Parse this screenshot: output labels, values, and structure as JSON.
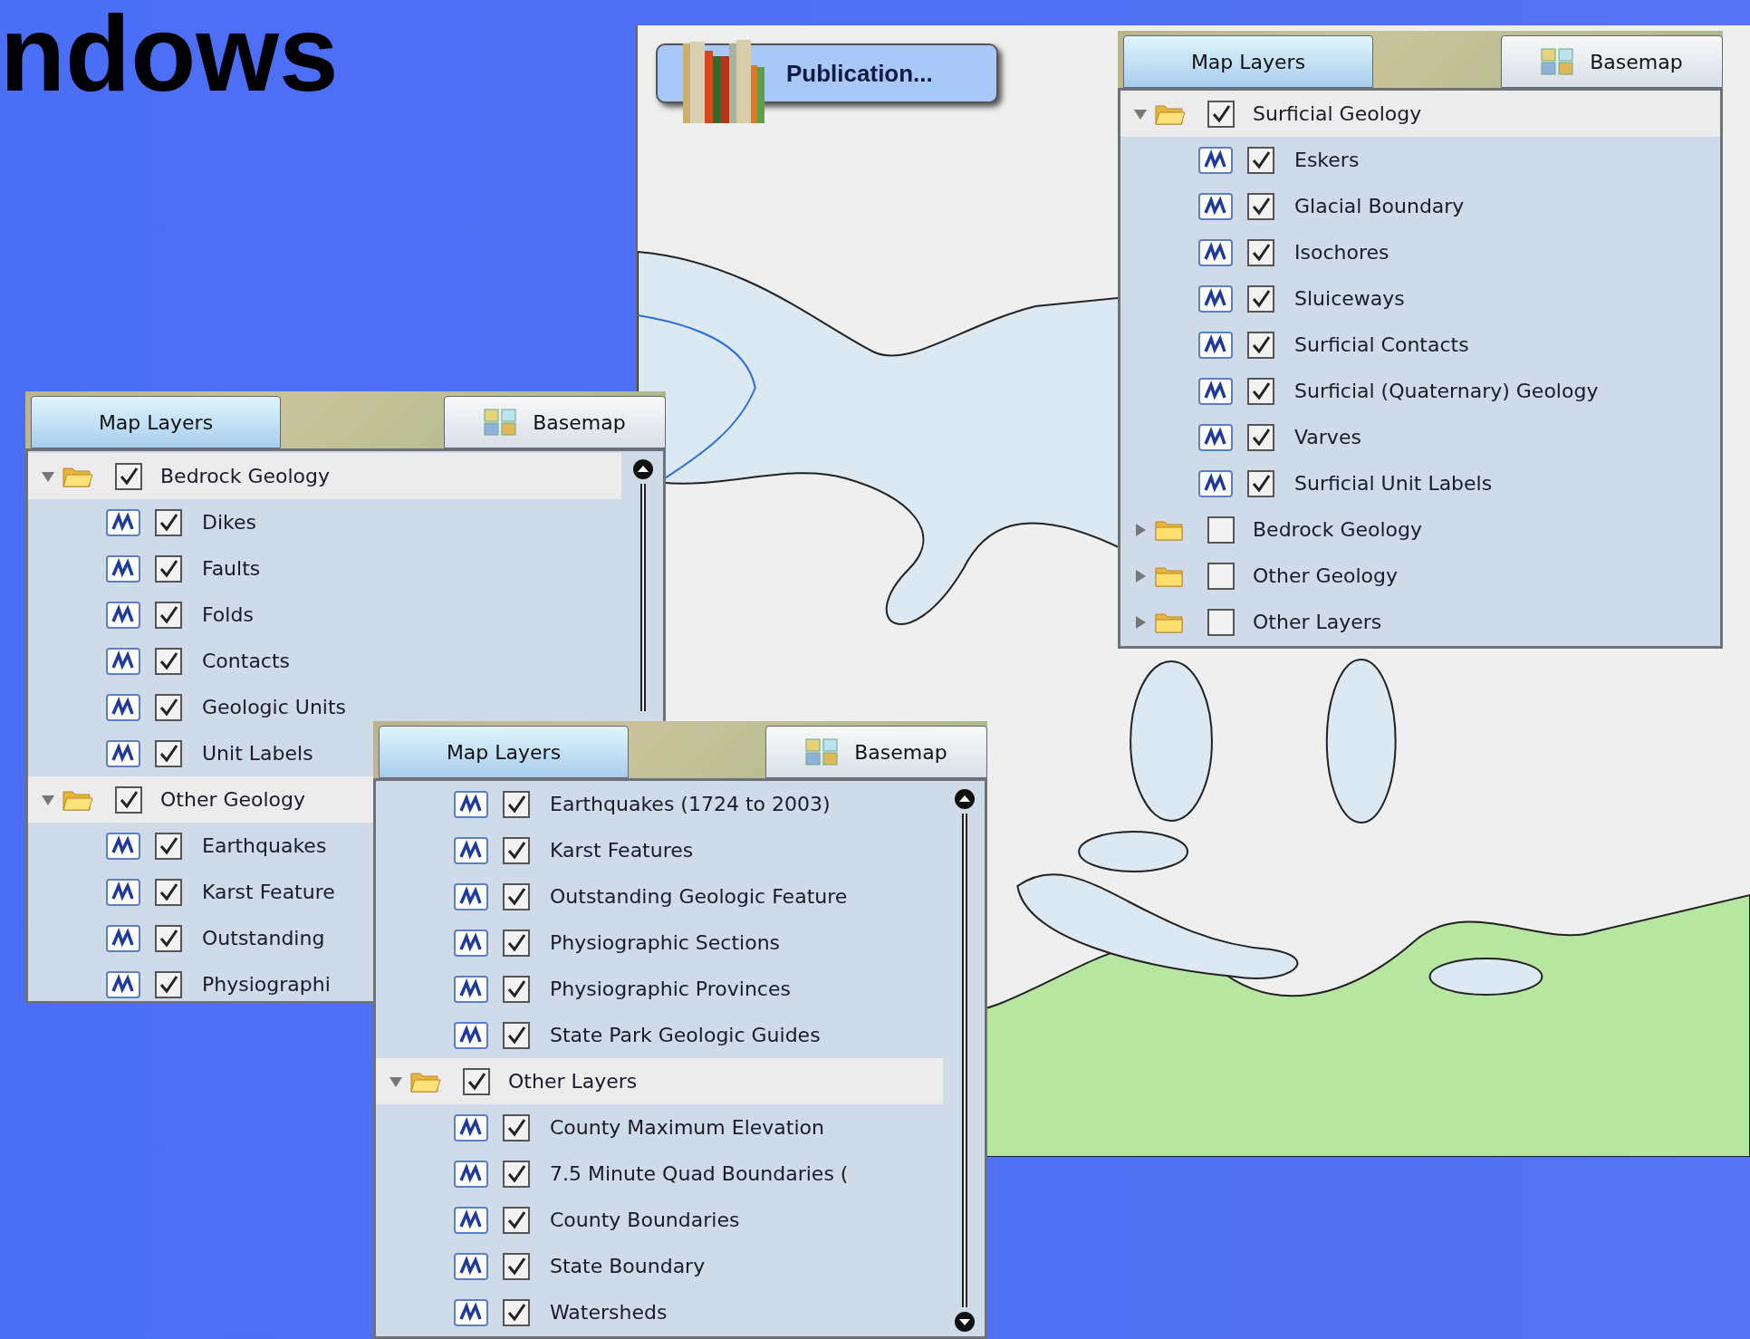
{
  "slide": {
    "title": "ndows"
  },
  "map_window": {
    "publication_button": {
      "label": "Publication..."
    },
    "layer_panel": {
      "tabs": [
        {
          "label": "Map Layers",
          "selected": true
        },
        {
          "label": "Basemap",
          "selected": false
        }
      ],
      "tree": [
        {
          "kind": "group",
          "label": "Surficial Geology",
          "checked": true,
          "expanded": true,
          "children": [
            {
              "kind": "layer",
              "label": "Eskers",
              "checked": true
            },
            {
              "kind": "layer",
              "label": "Glacial Boundary",
              "checked": true
            },
            {
              "kind": "layer",
              "label": "Isochores",
              "checked": true
            },
            {
              "kind": "layer",
              "label": "Sluiceways",
              "checked": true
            },
            {
              "kind": "layer",
              "label": "Surficial Contacts",
              "checked": true
            },
            {
              "kind": "layer",
              "label": "Surficial (Quaternary) Geology",
              "checked": true
            },
            {
              "kind": "layer",
              "label": "Varves",
              "checked": true
            },
            {
              "kind": "layer",
              "label": "Surficial Unit Labels",
              "checked": true
            }
          ]
        },
        {
          "kind": "group",
          "label": "Bedrock Geology",
          "checked": false,
          "expanded": false
        },
        {
          "kind": "group",
          "label": "Other Geology",
          "checked": false,
          "expanded": false
        },
        {
          "kind": "group",
          "label": "Other Layers",
          "checked": false,
          "expanded": false
        }
      ]
    }
  },
  "left_panel": {
    "tabs": [
      {
        "label": "Map Layers",
        "selected": true
      },
      {
        "label": "Basemap",
        "selected": false
      }
    ],
    "tree": [
      {
        "kind": "group",
        "label": "Bedrock Geology",
        "checked": true,
        "expanded": true,
        "children": [
          {
            "kind": "layer",
            "label": "Dikes",
            "checked": true
          },
          {
            "kind": "layer",
            "label": "Faults",
            "checked": true
          },
          {
            "kind": "layer",
            "label": "Folds",
            "checked": true
          },
          {
            "kind": "layer",
            "label": "Contacts",
            "checked": true
          },
          {
            "kind": "layer",
            "label": "Geologic Units",
            "checked": true
          },
          {
            "kind": "layer",
            "label": "Unit Labels",
            "checked": true
          }
        ]
      },
      {
        "kind": "group",
        "label": "Other Geology",
        "checked": true,
        "expanded": true,
        "children": [
          {
            "kind": "layer",
            "label": "Earthquakes",
            "checked": true
          },
          {
            "kind": "layer",
            "label": "Karst Feature",
            "checked": true
          },
          {
            "kind": "layer",
            "label": "Outstanding",
            "checked": true
          },
          {
            "kind": "layer",
            "label": "Physiographi",
            "checked": true
          }
        ]
      }
    ]
  },
  "front_panel": {
    "tabs": [
      {
        "label": "Map Layers",
        "selected": true
      },
      {
        "label": "Basemap",
        "selected": false
      }
    ],
    "tree": [
      {
        "kind": "group",
        "children": [
          {
            "kind": "layer",
            "label": "Earthquakes (1724 to 2003)",
            "checked": true
          },
          {
            "kind": "layer",
            "label": "Karst Features",
            "checked": true
          },
          {
            "kind": "layer",
            "label": "Outstanding Geologic Feature",
            "checked": true
          },
          {
            "kind": "layer",
            "label": "Physiographic Sections",
            "checked": true
          },
          {
            "kind": "layer",
            "label": "Physiographic Provinces",
            "checked": true
          },
          {
            "kind": "layer",
            "label": "State Park Geologic Guides",
            "checked": true
          }
        ]
      },
      {
        "kind": "group",
        "label": "Other Layers",
        "checked": true,
        "expanded": true,
        "children": [
          {
            "kind": "layer",
            "label": "County Maximum Elevation",
            "checked": true
          },
          {
            "kind": "layer",
            "label": "7.5 Minute Quad Boundaries (",
            "checked": true
          },
          {
            "kind": "layer",
            "label": "County Boundaries",
            "checked": true
          },
          {
            "kind": "layer",
            "label": "State Boundary",
            "checked": true
          },
          {
            "kind": "layer",
            "label": "Watersheds",
            "checked": true
          }
        ]
      }
    ]
  }
}
